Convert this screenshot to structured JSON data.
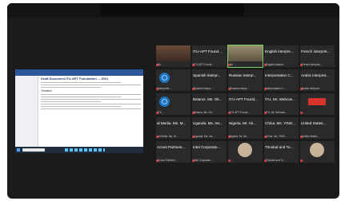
{
  "meeting": {
    "shared_doc": {
      "title": "Draft Document ITU-APT Foundation ... 2021",
      "heading": "Tentative"
    },
    "tiles": [
      {
        "name": "",
        "sub": "Mr. ...",
        "kind": "photo"
      },
      {
        "name": "ITU-APT Found...",
        "sub": "ITU-APT Found...",
        "kind": "dark"
      },
      {
        "name": "",
        "sub": "Mr. ...",
        "kind": "photo-speaker"
      },
      {
        "name": "English interpre...",
        "sub": "English interpre...",
        "kind": "dark"
      },
      {
        "name": "French interpret...",
        "sub": "French interpret...",
        "kind": "dark"
      },
      {
        "name": "",
        "sub": "Interpreter ...",
        "kind": "logo"
      },
      {
        "name": "Spanish interpr...",
        "sub": "Spanish interpr...",
        "kind": "dark"
      },
      {
        "name": "Russian interpr...",
        "sub": "Russian interpr...",
        "kind": "dark"
      },
      {
        "name": "Interpretation C...",
        "sub": "Interpretation C...",
        "kind": "dark"
      },
      {
        "name": "Arabic interpret...",
        "sub": "Arabic interpret...",
        "kind": "dark"
      },
      {
        "name": "",
        "sub": "ITU ...",
        "kind": "logo"
      },
      {
        "name": "Belarus. Ms. Ok...",
        "sub": "Belarus. Ms. Ok...",
        "kind": "dark"
      },
      {
        "name": "ITU-APT Found...",
        "sub": "ITU-APT Found...",
        "kind": "dark"
      },
      {
        "name": "ITU. Mr. Webcas...",
        "sub": "ITU. Mr. Webcas...",
        "kind": "dark"
      },
      {
        "name": "",
        "sub": "...",
        "kind": "red"
      },
      {
        "name": "al Media. Ms. M...",
        "sub": "al Media. Ms. M...",
        "kind": "dark"
      },
      {
        "name": "Uganda. Ms. Ins...",
        "sub": "Uganda. Ms. Ins...",
        "kind": "dark"
      },
      {
        "name": "Nigeria. Mr. Ab...",
        "sub": "Nigeria. Mr. Ab...",
        "kind": "dark"
      },
      {
        "name": "China. Ms. YING...",
        "sub": "China. Ms. YING...",
        "kind": "dark"
      },
      {
        "name": "United States...",
        "sub": "United States...",
        "kind": "dark"
      },
      {
        "name": "Acnus Partners...",
        "sub": "Acnus Partners...",
        "kind": "dark"
      },
      {
        "name": "Intel Corporate...",
        "sub": "Intel Corporate...",
        "kind": "dark"
      },
      {
        "name": "",
        "sub": "...",
        "kind": "person"
      },
      {
        "name": "Trinidad and To...",
        "sub": "Trinidad and To...",
        "kind": "dark"
      },
      {
        "name": "",
        "sub": "...",
        "kind": "person"
      }
    ]
  }
}
